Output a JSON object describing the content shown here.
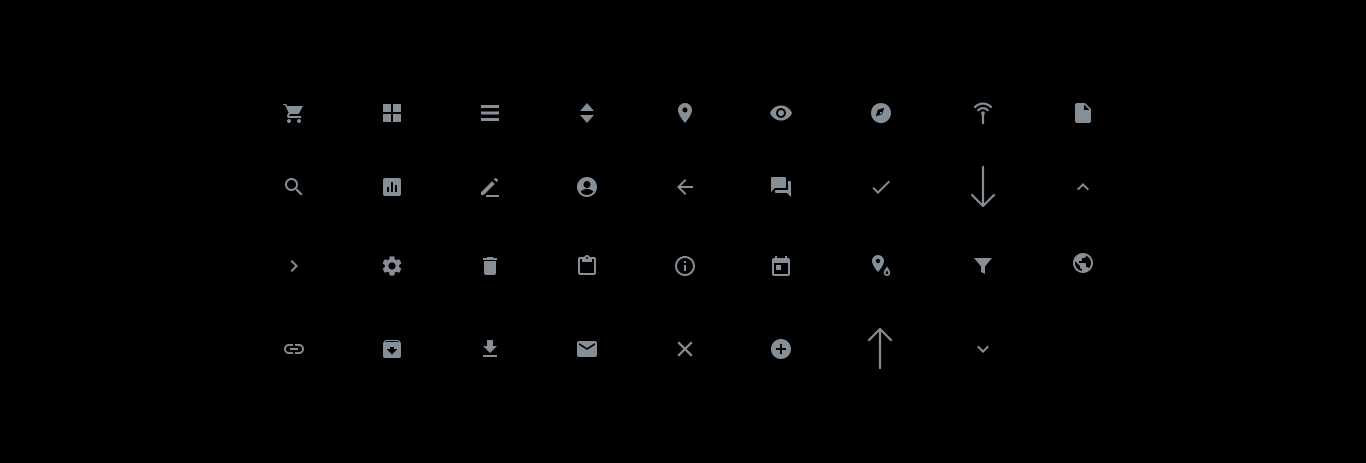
{
  "colors": {
    "background": "#000000",
    "icon": "#868e96"
  },
  "icons": {
    "row1": [
      "cart-icon",
      "grid-icon",
      "list-icon",
      "sort-icon",
      "map-pin-icon",
      "eye-icon",
      "compass-icon",
      "wifi-signal-icon",
      "file-icon"
    ],
    "row2": [
      "search-icon",
      "bar-chart-icon",
      "pencil-icon",
      "account-icon",
      "arrow-left-icon",
      "chat-icon",
      "check-icon",
      "arrow-down-long-icon",
      "chevron-up-icon"
    ],
    "row3": [
      "chevron-right-icon",
      "gear-icon",
      "trash-icon",
      "clipboard-icon",
      "info-icon",
      "calendar-icon",
      "location-drop-icon",
      "filter-icon",
      "globe-icon"
    ],
    "row4": [
      "link-icon",
      "archive-icon",
      "download-icon",
      "mail-icon",
      "close-icon",
      "plus-circle-icon",
      "arrow-up-long-icon",
      "chevron-down-icon"
    ]
  }
}
